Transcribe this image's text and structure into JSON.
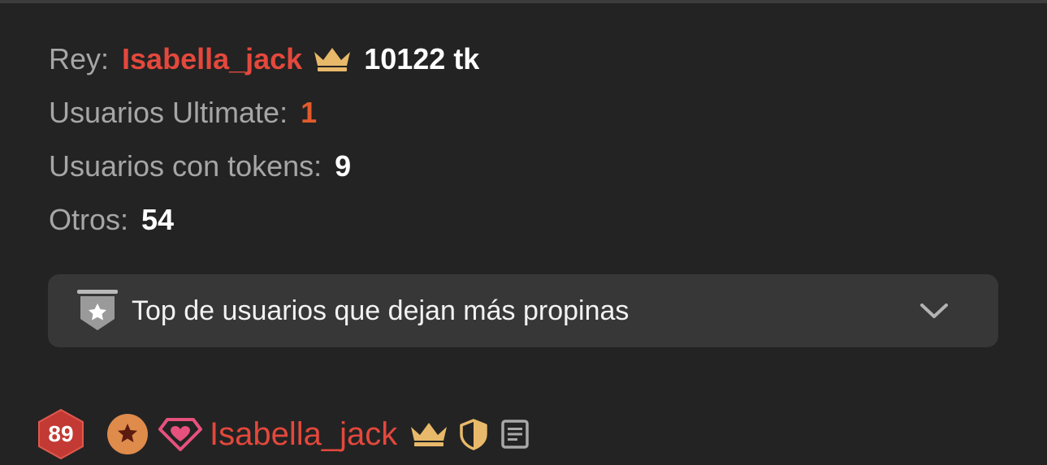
{
  "stats": {
    "king_label": "Rey:",
    "king_name": "Isabella_jack",
    "king_tokens": "10122 tk",
    "ultimate_label": "Usuarios Ultimate:",
    "ultimate_value": "1",
    "tokens_label": "Usuarios con tokens:",
    "tokens_value": "9",
    "others_label": "Otros:",
    "others_value": "54"
  },
  "accordion": {
    "label": "Top de usuarios que dejan más propinas",
    "icon": "star-shield-icon",
    "toggle_icon": "chevron-down-icon"
  },
  "user": {
    "level": "89",
    "name": "Isabella_jack",
    "badges": [
      "star-badge-icon",
      "diamond-heart-icon",
      "crown-icon",
      "shield-icon",
      "notes-icon"
    ]
  },
  "colors": {
    "background": "#232323",
    "panel": "#373737",
    "king_name": "#e4483c",
    "ultimate": "#e35a2c",
    "crown": "#e8b96a",
    "label": "#a6a6a6"
  }
}
